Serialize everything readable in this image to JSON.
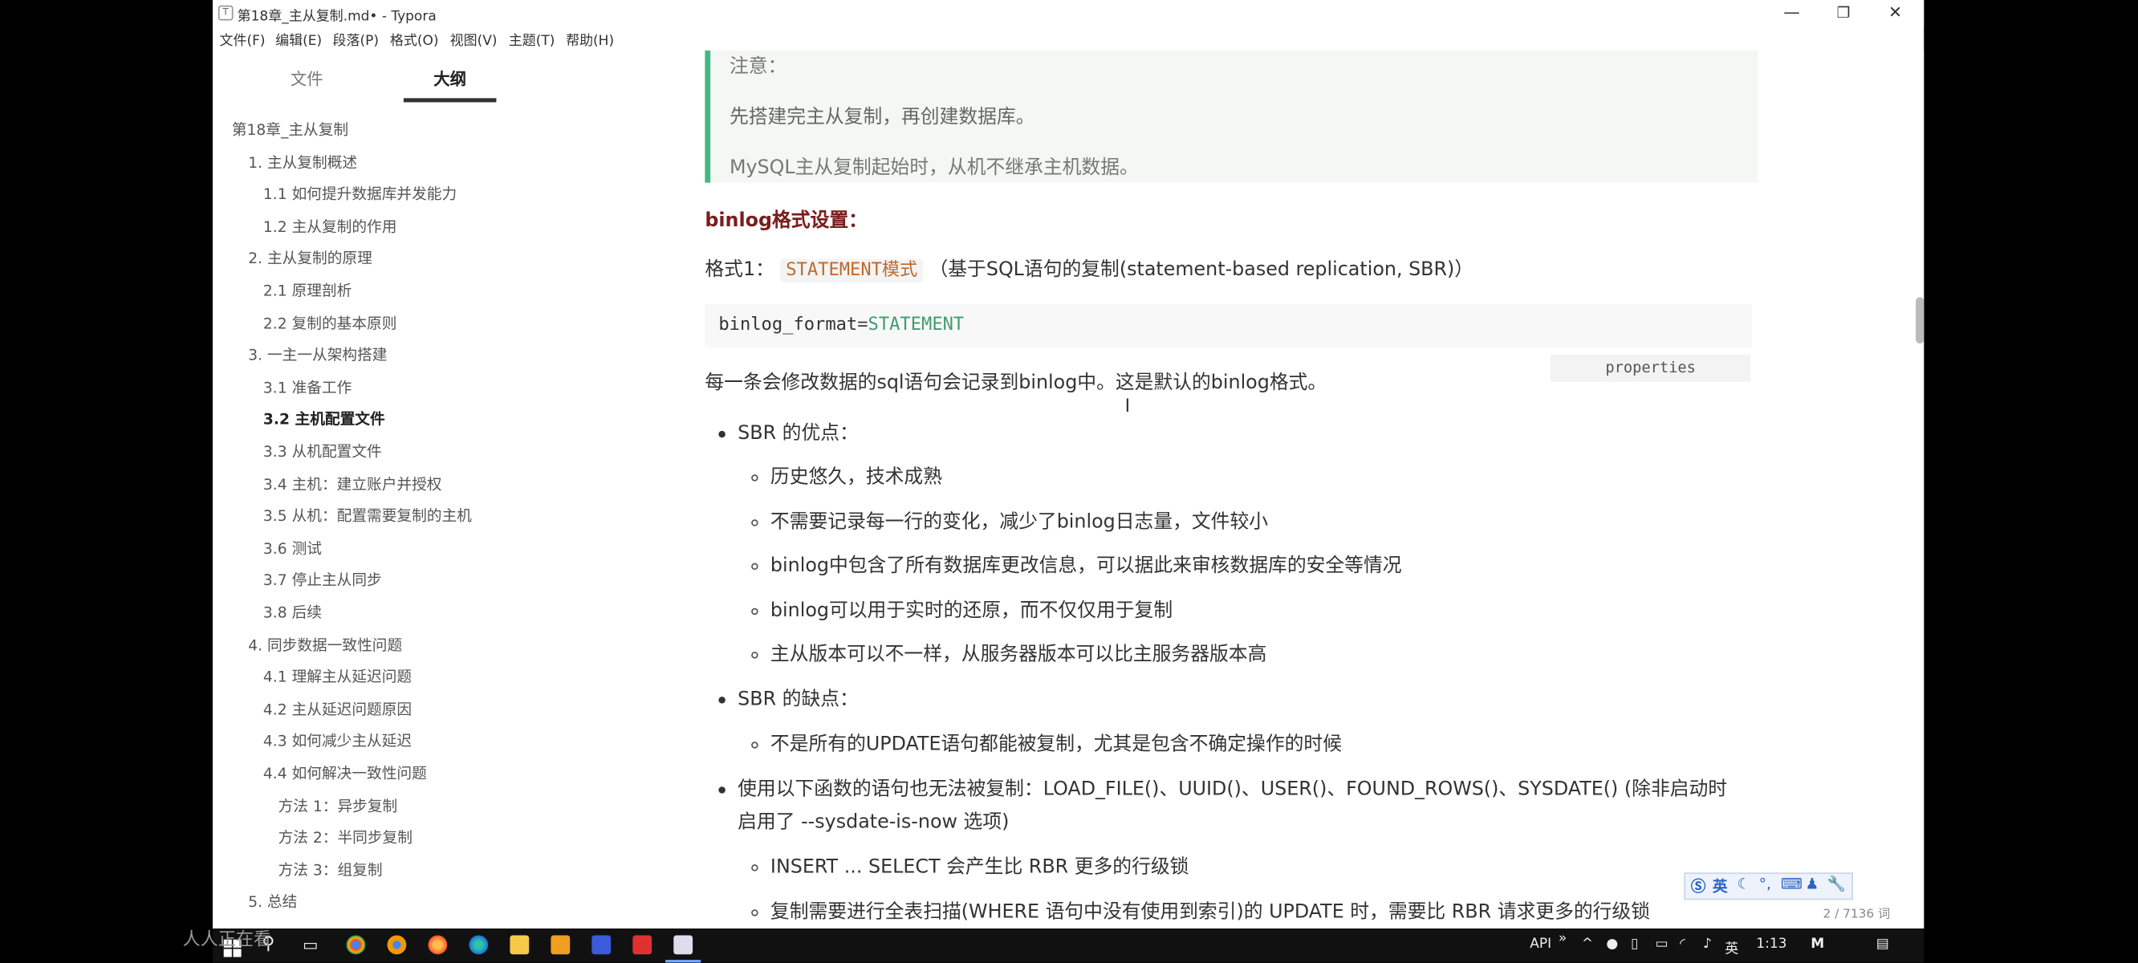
{
  "window": {
    "title": "第18章_主从复制.md• - Typora",
    "app_icon": "T",
    "controls": {
      "minimize": "—",
      "maximize": "❐",
      "close": "✕"
    }
  },
  "menu": [
    "文件(F)",
    "编辑(E)",
    "段落(P)",
    "格式(O)",
    "视图(V)",
    "主题(T)",
    "帮助(H)"
  ],
  "sidebar": {
    "tab_files": "文件",
    "tab_outline": "大纲",
    "outline": [
      {
        "label": "第18章_主从复制",
        "level": 1
      },
      {
        "label": "1. 主从复制概述",
        "level": 2
      },
      {
        "label": "1.1 如何提升数据库并发能力",
        "level": 3
      },
      {
        "label": "1.2 主从复制的作用",
        "level": 3
      },
      {
        "label": "2. 主从复制的原理",
        "level": 2
      },
      {
        "label": "2.1 原理剖析",
        "level": 3
      },
      {
        "label": "2.2 复制的基本原则",
        "level": 3
      },
      {
        "label": "3. 一主一从架构搭建",
        "level": 2
      },
      {
        "label": "3.1 准备工作",
        "level": 3
      },
      {
        "label": "3.2 主机配置文件",
        "level": 3,
        "active": true
      },
      {
        "label": "3.3 从机配置文件",
        "level": 3
      },
      {
        "label": "3.4 主机：建立账户并授权",
        "level": 3
      },
      {
        "label": "3.5 从机：配置需要复制的主机",
        "level": 3
      },
      {
        "label": "3.6 测试",
        "level": 3
      },
      {
        "label": "3.7 停止主从同步",
        "level": 3
      },
      {
        "label": "3.8 后续",
        "level": 3
      },
      {
        "label": "4. 同步数据一致性问题",
        "level": 2
      },
      {
        "label": "4.1 理解主从延迟问题",
        "level": 3
      },
      {
        "label": "4.2 主从延迟问题原因",
        "level": 3
      },
      {
        "label": "4.3 如何减少主从延迟",
        "level": 3
      },
      {
        "label": "4.4 如何解决一致性问题",
        "level": 3
      },
      {
        "label": "方法 1：异步复制",
        "level": 4
      },
      {
        "label": "方法 2：半同步复制",
        "level": 4
      },
      {
        "label": "方法 3：组复制",
        "level": 4
      },
      {
        "label": "5. 总结",
        "level": 2
      }
    ],
    "footer_left": "‹",
    "footer_source": "</>"
  },
  "content": {
    "note_title": "注意：",
    "note_line1": "先搭建完主从复制，再创建数据库。",
    "note_line2": "MySQL主从复制起始时，从机不继承主机数据。",
    "heading": "binlog格式设置：",
    "format1_prefix": "格式1：",
    "format1_code": "STATEMENT模式",
    "format1_desc": "（基于SQL语句的复制(statement-based replication, SBR)）",
    "code_key": "binlog_format",
    "code_eq": "=",
    "code_value": "STATEMENT",
    "code_lang": "properties",
    "para1": "每一条会修改数据的sql语句会记录到binlog中。这是默认的binlog格式。",
    "sbr_pros": "SBR 的优点：",
    "pros": [
      "历史悠久，技术成熟",
      "不需要记录每一行的变化，减少了binlog日志量，文件较小",
      "binlog中包含了所有数据库更改信息，可以据此来审核数据库的安全等情况",
      "binlog可以用于实时的还原，而不仅仅用于复制",
      "主从版本可以不一样，从服务器版本可以比主服务器版本高"
    ],
    "sbr_cons": "SBR 的缺点：",
    "cons": [
      "不是所有的UPDATE语句都能被复制，尤其是包含不确定操作的时候"
    ],
    "func_line1": "使用以下函数的语句也无法被复制：LOAD_FILE()、UUID()、USER()、FOUND_ROWS()、SYSDATE() (除非启动时",
    "func_line2": "启用了 --sysdate-is-now 选项)",
    "sub": [
      "INSERT ... SELECT 会产生比 RBR 更多的行级锁",
      "复制需要进行全表扫描(WHERE 语句中没有使用到索引)的 UPDATE 时，需要比 RBR 请求更多的行级锁"
    ],
    "word_count": "2 / 7136 词",
    "ime": "英"
  },
  "taskbar": {
    "tray_api": "API",
    "tray_lang": "英",
    "clock": "1:13",
    "watermark": "人人正在看"
  }
}
